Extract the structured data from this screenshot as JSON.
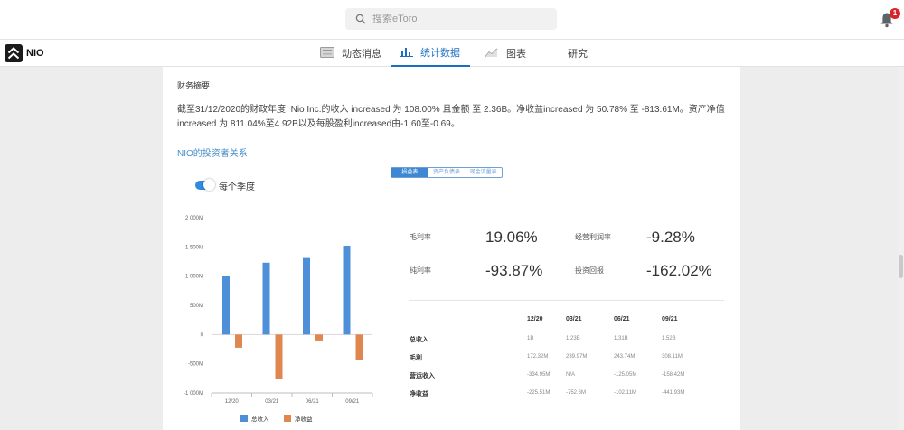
{
  "search": {
    "placeholder": "搜索eToro"
  },
  "notifications": {
    "count": "1"
  },
  "instrument": {
    "ticker": "NIO"
  },
  "tabs": [
    {
      "label": "动态消息",
      "icon": "news-feed-icon"
    },
    {
      "label": "统计数据",
      "icon": "bar-stats-icon"
    },
    {
      "label": "图表",
      "icon": "line-chart-icon"
    },
    {
      "label": "研究",
      "icon": ""
    }
  ],
  "colors": {
    "accent": "#1c6ec1",
    "revenue": "#4d8fd8",
    "net_income": "#e0864f"
  },
  "financial": {
    "section_title": "财务摘要",
    "summary": "截至31/12/2020的财政年度: Nio Inc.的收入 increased 为 108.00% 且金额 至 2.36B。净收益increased 为 50.78% 至 -813.61M。资产净值increased 为 811.04%至4.92B以及每股盈利increased由-1.60至-0.69。",
    "investor_link": "NIO的投资者关系",
    "toggle_label": "每个季度",
    "statement_tabs": [
      "损益表",
      "资产负债表",
      "现金流量表"
    ]
  },
  "metrics": [
    {
      "label": "毛利率",
      "value": "19.06%"
    },
    {
      "label": "经营利润率",
      "value": "-9.28%"
    },
    {
      "label": "纯利率",
      "value": "-93.87%"
    },
    {
      "label": "投资回报",
      "value": "-162.02%"
    }
  ],
  "table": {
    "headers": [
      "12/20",
      "03/21",
      "06/21",
      "09/21"
    ],
    "rows": [
      {
        "label": "总收入",
        "cells": [
          "1B",
          "1.23B",
          "1.31B",
          "1.52B"
        ]
      },
      {
        "label": "毛利",
        "cells": [
          "172.32M",
          "239.97M",
          "243.74M",
          "308.11M"
        ]
      },
      {
        "label": "营运收入",
        "cells": [
          "-334.95M",
          "N/A",
          "-125.05M",
          "-158.42M"
        ]
      },
      {
        "label": "净收益",
        "cells": [
          "-225.51M",
          "-752.6M",
          "-102.11M",
          "-441.93M"
        ]
      }
    ]
  },
  "chart_data": {
    "type": "bar",
    "categories": [
      "12/20",
      "03/21",
      "06/21",
      "09/21"
    ],
    "series": [
      {
        "name": "总收入",
        "values": [
          1000,
          1230,
          1310,
          1520
        ]
      },
      {
        "name": "净收益",
        "values": [
          -225.51,
          -752.6,
          -102.11,
          -441.93
        ]
      }
    ],
    "yticks": [
      "2 000M",
      "1 500M",
      "1 000M",
      "500M",
      "0",
      "-500M",
      "-1 000M"
    ],
    "ylim": [
      -1000,
      2000
    ],
    "legend": "bottom",
    "grid": false
  }
}
